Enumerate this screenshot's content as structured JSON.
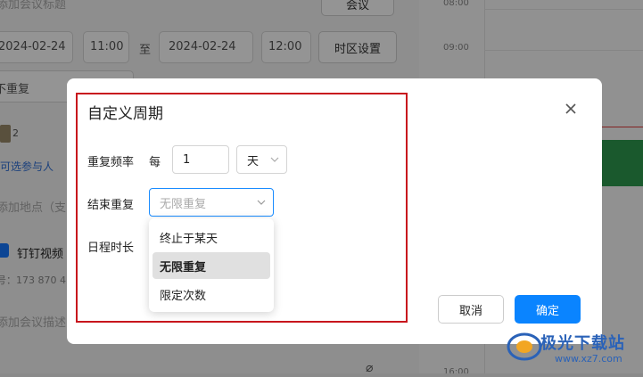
{
  "background": {
    "title_placeholder": "添加会议标题",
    "type_select": "会议",
    "start_date": "2024-02-24",
    "start_time": "11:00",
    "to_label": "至",
    "end_date": "2024-02-24",
    "end_time": "12:00",
    "timezone_button": "时区设置",
    "repeat_value": "不重复",
    "attendee_count": "2",
    "optional_attendees_link": "可选参与人",
    "location_placeholder": "添加地点（支",
    "dingtalk_video_label": "钉钉视频",
    "meeting_id": "号：173 870 4",
    "description_placeholder": "添加会议描述",
    "time_labels": [
      "08:00",
      "09:00",
      "16:00"
    ]
  },
  "dialog": {
    "title": "自定义周期",
    "frequency_label": "重复频率",
    "every_label": "每",
    "frequency_value": "1",
    "unit_value": "天",
    "end_label": "结束重复",
    "end_select_value": "无限重复",
    "duration_label": "日程时长",
    "dropdown_options": [
      "终止于某天",
      "无限重复",
      "限定次数"
    ],
    "selected_option_index": 1,
    "cancel_label": "取消",
    "confirm_label": "确定"
  },
  "watermark": {
    "text": "极光下载站",
    "url": "www.xz7.com"
  },
  "colors": {
    "accent": "#0a84ff",
    "highlight_border": "#c8161d",
    "event_green": "#2e9a4e"
  }
}
